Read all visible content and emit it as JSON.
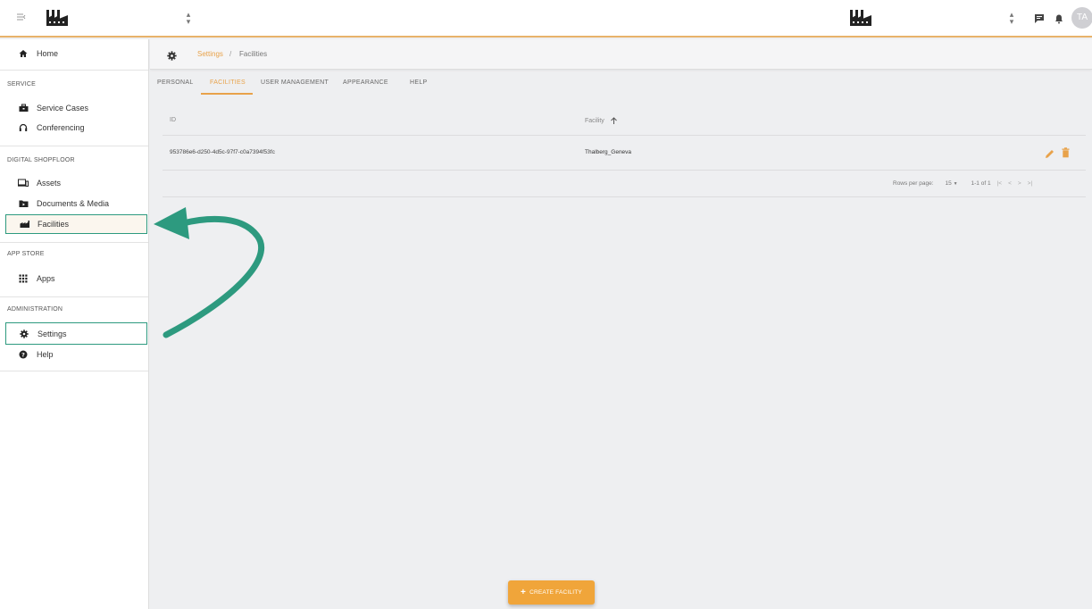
{
  "header": {
    "user_initials": "TA"
  },
  "sidebar": {
    "home": "Home",
    "sections": {
      "service": "SERVICE",
      "digital_shopfloor": "DIGITAL SHOPFLOOR",
      "app_store": "APP STORE",
      "administration": "ADMINISTRATION"
    },
    "items": {
      "service_cases": "Service Cases",
      "conferencing": "Conferencing",
      "assets": "Assets",
      "documents_media": "Documents & Media",
      "facilities": "Facilities",
      "apps": "Apps",
      "settings": "Settings",
      "help": "Help"
    }
  },
  "breadcrumb": {
    "root": "Settings",
    "separator": "/",
    "current": "Facilities"
  },
  "tabs": [
    "PERSONAL",
    "FACILITIES",
    "USER MANAGEMENT",
    "APPEARANCE",
    "HELP"
  ],
  "table": {
    "columns": {
      "id": "ID",
      "facility": "Facility"
    },
    "rows": [
      {
        "id": "953786e6-d250-4d5c-97f7-c0a7394f53fc",
        "facility": "Thalberg_Geneva"
      }
    ],
    "footer": {
      "rows_per_page_label": "Rows per page:",
      "rows_per_page_value": "15",
      "range": "1-1 of 1"
    }
  },
  "actions": {
    "create_facility": "CREATE FACILITY"
  },
  "colors": {
    "accent": "#e8a24a",
    "annotation": "#2d9a7f"
  }
}
